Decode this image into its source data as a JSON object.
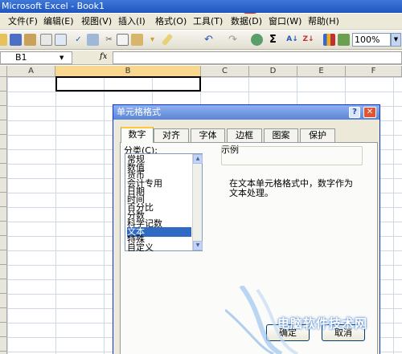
{
  "window": {
    "title": "Microsoft Excel - Book1"
  },
  "menu": {
    "items": [
      "文件(F)",
      "编辑(E)",
      "视图(V)",
      "插入(I)",
      "格式(O)",
      "工具(T)",
      "数据(D)",
      "窗口(W)",
      "帮助(H)"
    ]
  },
  "toolbar": {
    "icons": [
      "open-icon",
      "save-icon",
      "permission-icon",
      "print-icon",
      "print-preview-icon",
      "spelling-icon",
      "research-icon",
      "cut-icon",
      "copy-icon",
      "paste-icon",
      "format-painter-icon",
      "undo-icon",
      "redo-icon",
      "hyperlink-icon",
      "autosum-icon",
      "sort-ascending-icon",
      "sort-descending-icon",
      "chart-wizard-icon",
      "drawing-icon"
    ],
    "sum_symbol": "Σ",
    "zoom": "100%"
  },
  "formula_bar": {
    "name_box": "B1",
    "fx": "fx",
    "value": ""
  },
  "grid": {
    "columns": [
      "A",
      "B",
      "C",
      "D",
      "E",
      "F"
    ],
    "selected_column": "B",
    "selected_cell": "B1",
    "row_labels": [
      "",
      "",
      "",
      "",
      "",
      "",
      "",
      "",
      "",
      "",
      "",
      "",
      "",
      "",
      "",
      "",
      "",
      "",
      ""
    ]
  },
  "dialog": {
    "title": "单元格格式",
    "help_glyph": "?",
    "close_glyph": "✕",
    "tabs": [
      "数字",
      "对齐",
      "字体",
      "边框",
      "图案",
      "保护"
    ],
    "active_tab": "数字",
    "category_label": "分类(C):",
    "categories": [
      "常规",
      "数值",
      "货币",
      "会计专用",
      "日期",
      "时间",
      "百分比",
      "分数",
      "科学记数",
      "文本",
      "特殊",
      "自定义"
    ],
    "selected_category": "文本",
    "sample_label": "示例",
    "description": "在文本单元格格式中，数字作为文本处理。",
    "ok_label": "确定",
    "cancel_label": "取消"
  },
  "watermark": {
    "text": "电脑软件技术网"
  },
  "colors": {
    "title_bar": "#1f55c0",
    "menu_bg": "#ece9d8",
    "selection": "#316ac5",
    "active_tab_accent": "#ffc83c",
    "red_circle": "#e0302a"
  }
}
